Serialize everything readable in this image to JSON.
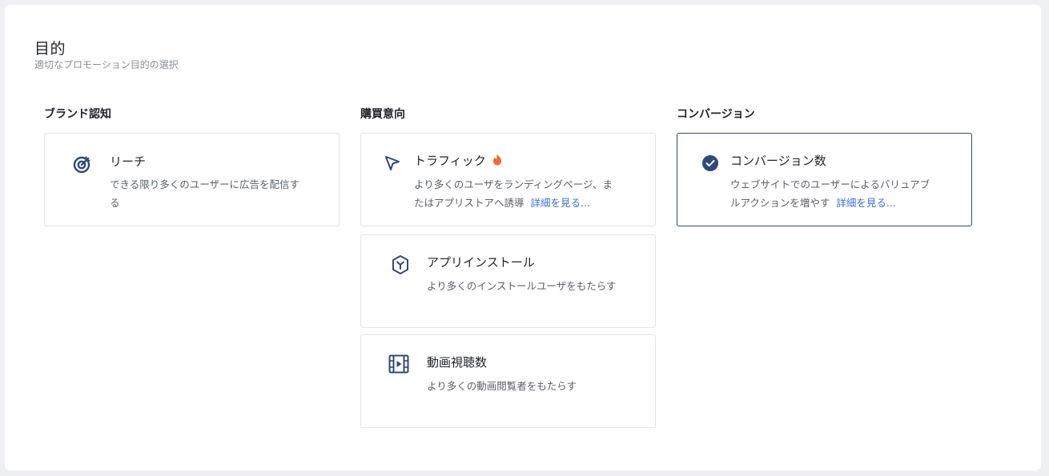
{
  "header": {
    "title": "目的",
    "subtitle": "適切なプロモーション目的の選択"
  },
  "columns": [
    {
      "title": "ブランド認知",
      "cards": [
        {
          "name": "リーチ",
          "icon": "target-icon",
          "desc_line1": "できる限り多くのユーザーに広告を配信す",
          "desc_line2": "る"
        }
      ]
    },
    {
      "title": "購買意向",
      "cards": [
        {
          "name": "トラフィック",
          "icon": "cursor-arrow-icon",
          "badge_icon": "fire-icon",
          "desc_line1": "より多くのユーザをランディングページ、ま",
          "desc_line2": "たはアプリストアへ誘導",
          "link": "詳細を見る..."
        },
        {
          "name": "アプリインストール",
          "icon": "app-box-icon",
          "desc_line1": "より多くのインストールユーザをもたらす"
        },
        {
          "name": "動画視聴数",
          "icon": "video-film-icon",
          "desc_line1": "より多くの動画閲覧者をもたらす"
        }
      ]
    },
    {
      "title": "コンバージョン",
      "cards": [
        {
          "name": "コンバージョン数",
          "icon": "check-circle-icon",
          "selected": true,
          "desc_line1": "ウェブサイトでのユーザーによるバリュアブ",
          "desc_line2": "ルアクションを増やす",
          "link": "詳細を見る..."
        }
      ]
    }
  ],
  "colors": {
    "accent": "#2f4a7a",
    "link": "#3f6fd8",
    "fire": "#f26b2a"
  }
}
